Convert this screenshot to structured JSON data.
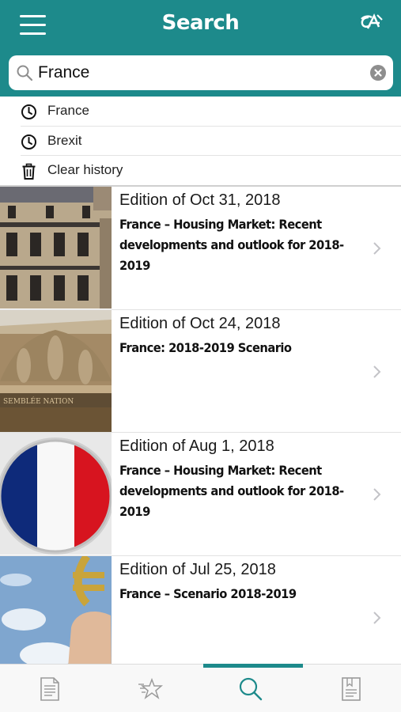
{
  "header": {
    "title": "Search",
    "brand_color": "#1d8a8b"
  },
  "search": {
    "value": "France",
    "placeholder": "Search"
  },
  "history": [
    {
      "icon": "clock-icon",
      "label": "France"
    },
    {
      "icon": "clock-icon",
      "label": "Brexit"
    },
    {
      "icon": "trash-icon",
      "label": "Clear history"
    }
  ],
  "results": [
    {
      "edition": "Edition of Oct 31, 2018",
      "title": "France – Housing Market: Recent developments and outlook for 2018-2019",
      "thumb": "paris-building"
    },
    {
      "edition": "Edition of Oct 24, 2018",
      "title": "France: 2018-2019 Scenario",
      "thumb": "assemblee-nationale"
    },
    {
      "edition": "Edition of Aug 1, 2018",
      "title": "France – Housing Market: Recent developments and outlook for 2018-2019",
      "thumb": "french-flag-button"
    },
    {
      "edition": "Edition of Jul 25, 2018",
      "title": "France – Scenario 2018-2019",
      "thumb": "euro-sign-hand"
    }
  ],
  "tabs": [
    {
      "icon": "document-icon",
      "active": false
    },
    {
      "icon": "favorites-icon",
      "active": false
    },
    {
      "icon": "search-icon",
      "active": true
    },
    {
      "icon": "bookmark-icon",
      "active": false
    }
  ]
}
